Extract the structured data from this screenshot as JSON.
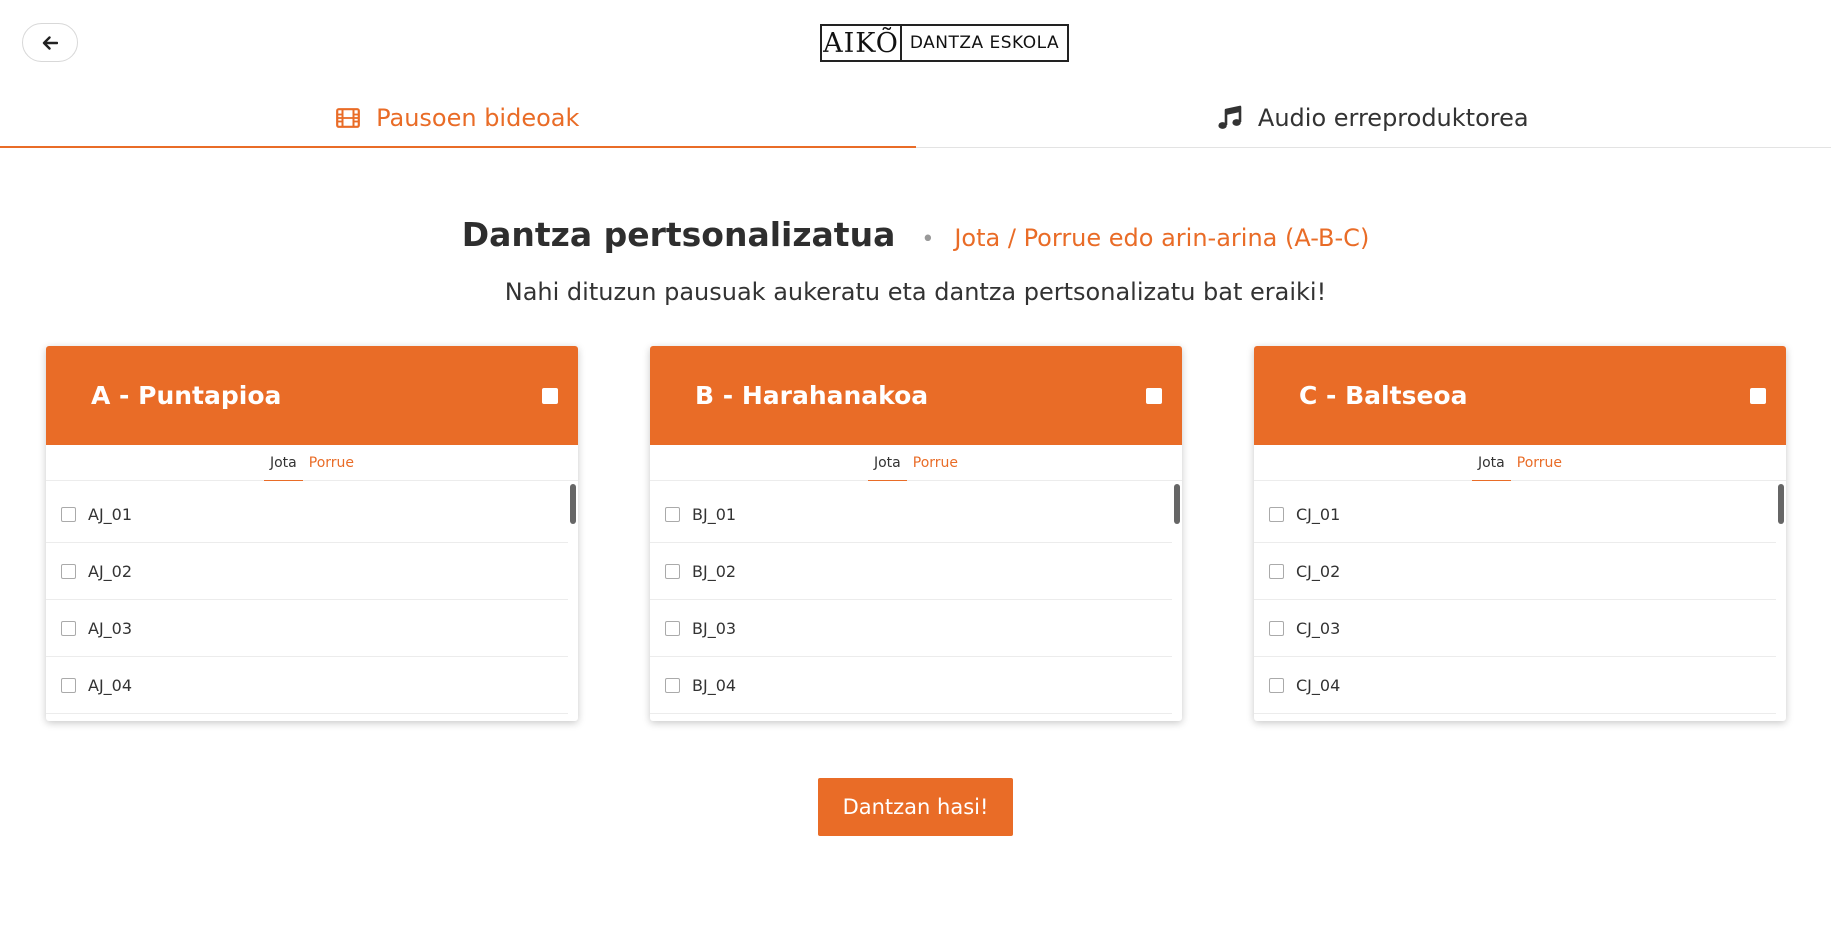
{
  "header": {
    "logo_left": "AIKÕ",
    "logo_right": "DANTZA ESKOLA"
  },
  "tabs": [
    {
      "label": "Pausoen bideoak",
      "icon": "film-icon",
      "active": true
    },
    {
      "label": "Audio erreproduktorea",
      "icon": "music-icon",
      "active": false
    }
  ],
  "heading": {
    "title": "Dantza pertsonalizatua",
    "separator": "•",
    "subtitle": "Jota / Porrue edo arin-arina (A-B-C)"
  },
  "lead": "Nahi dituzun pausuak aukeratu eta dantza pertsonalizatu bat eraiki!",
  "accent_color": "#e96c27",
  "cards": [
    {
      "title": "A - Puntapioa",
      "subtabs": [
        "Jota",
        "Porrue"
      ],
      "active_subtab": "Jota",
      "items": [
        "AJ_01",
        "AJ_02",
        "AJ_03",
        "AJ_04"
      ]
    },
    {
      "title": "B - Harahanakoa",
      "subtabs": [
        "Jota",
        "Porrue"
      ],
      "active_subtab": "Jota",
      "items": [
        "BJ_01",
        "BJ_02",
        "BJ_03",
        "BJ_04"
      ]
    },
    {
      "title": "C - Baltseoa",
      "subtabs": [
        "Jota",
        "Porrue"
      ],
      "active_subtab": "Jota",
      "items": [
        "CJ_01",
        "CJ_02",
        "CJ_03",
        "CJ_04"
      ]
    }
  ],
  "start_button": "Dantzan hasi!"
}
